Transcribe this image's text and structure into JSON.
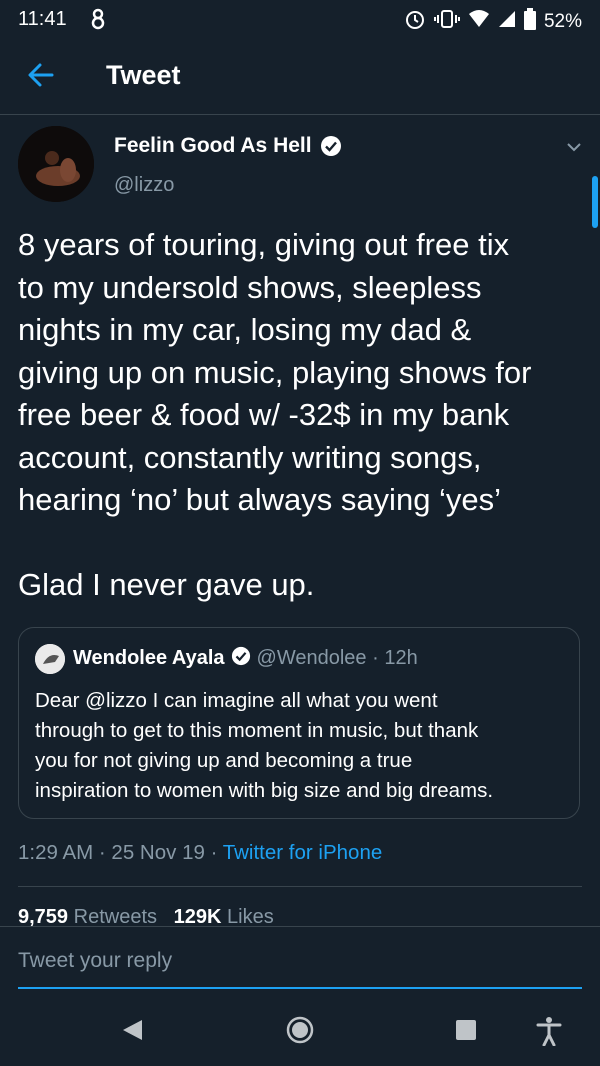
{
  "status": {
    "time": "11:41",
    "battery": "52%",
    "icons": [
      "app-notification-icon",
      "alarm-icon",
      "vibrate-icon",
      "wifi-icon",
      "signal-icon",
      "battery-icon"
    ]
  },
  "header": {
    "title": "Tweet"
  },
  "tweet": {
    "author_name": "Feelin Good As Hell",
    "author_handle": "@lizzo",
    "text": "8 years of touring, giving out free tix\nto my undersold shows, sleepless\nnights in my car, losing my dad &\ngiving up on music, playing shows for\nfree beer & food w/ -32$ in my bank\naccount, constantly writing songs,\nhearing ‘no’ but always saying ‘yes’\n\nGlad I never gave up.",
    "quote": {
      "author_name": "Wendolee Ayala",
      "author_handle": "@Wendolee · 12h",
      "text": "Dear @lizzo I can imagine all what you went\nthrough to get to this moment in music, but thank\nyou for not giving up and becoming a true\ninspiration to women with big size and big dreams."
    },
    "meta_time": "1:29 AM · 25 Nov 19 · ",
    "meta_source": "Twitter for iPhone",
    "retweets": "9,759",
    "retweets_label": "Retweets",
    "likes": "129K",
    "likes_label": "Likes"
  },
  "reply": {
    "placeholder": "Tweet your reply"
  },
  "colors": {
    "background": "#15202b",
    "accent": "#1da1f2",
    "muted": "#8899a6",
    "border": "#38444d"
  }
}
